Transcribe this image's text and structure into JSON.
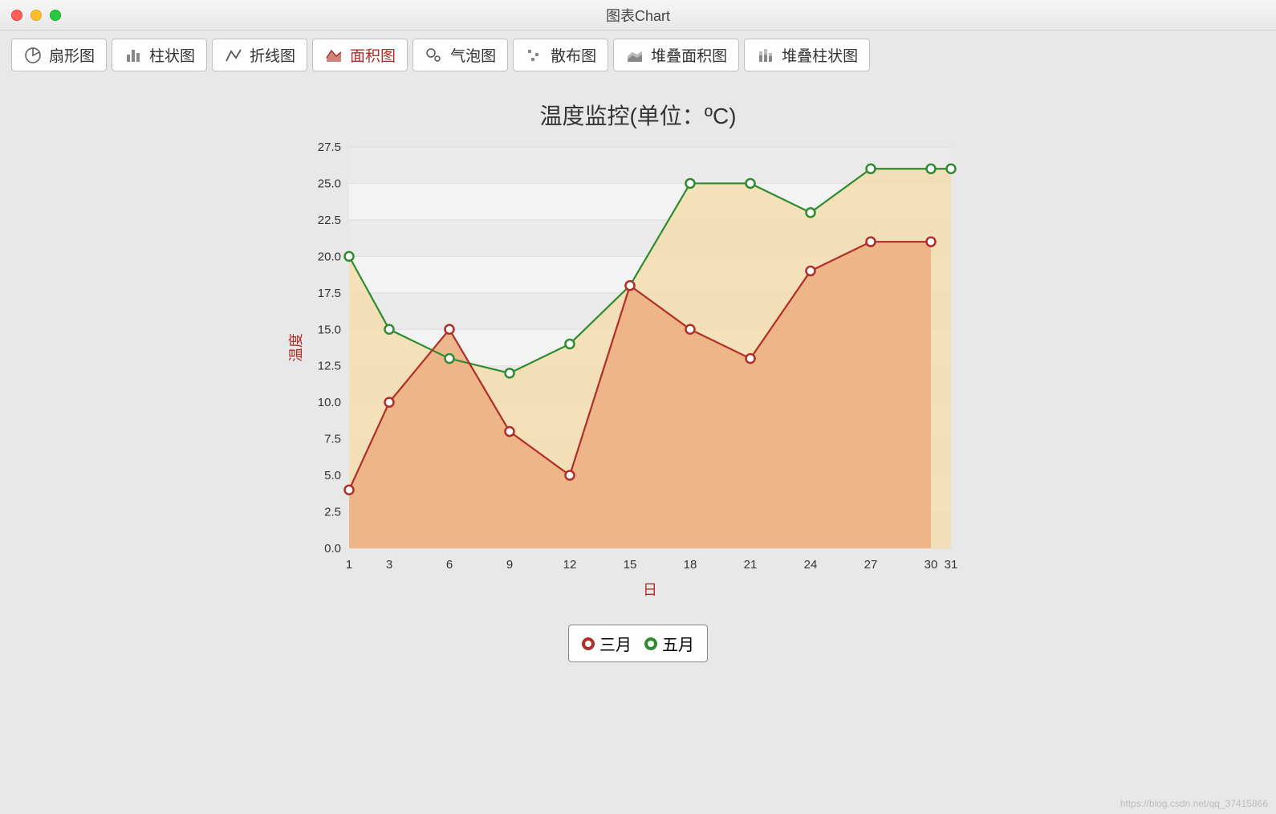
{
  "window": {
    "title": "图表Chart"
  },
  "tabs": [
    {
      "id": "pie",
      "label": "扇形图"
    },
    {
      "id": "bar",
      "label": "柱状图"
    },
    {
      "id": "line",
      "label": "折线图"
    },
    {
      "id": "area",
      "label": "面积图",
      "selected": true
    },
    {
      "id": "bubble",
      "label": "气泡图"
    },
    {
      "id": "scatter",
      "label": "散布图"
    },
    {
      "id": "stackedarea",
      "label": "堆叠面积图"
    },
    {
      "id": "stackedbar",
      "label": "堆叠柱状图"
    }
  ],
  "legend": {
    "series1": "三月",
    "series2": "五月"
  },
  "watermark": "https://blog.csdn.net/qq_37415866",
  "chart_data": {
    "type": "area",
    "title": "温度监控(单位：ºC)",
    "xlabel": "日",
    "ylabel": "温度",
    "x": [
      1,
      3,
      6,
      9,
      12,
      15,
      18,
      21,
      24,
      27,
      30,
      31
    ],
    "x_ticks": [
      "1",
      "3",
      "6",
      "9",
      "12",
      "15",
      "18",
      "21",
      "24",
      "27",
      "30",
      "31"
    ],
    "y_ticks": [
      "0.0",
      "2.5",
      "5.0",
      "7.5",
      "10.0",
      "12.5",
      "15.0",
      "17.5",
      "20.0",
      "22.5",
      "25.0",
      "27.5"
    ],
    "ylim": [
      0,
      27.5
    ],
    "series": [
      {
        "name": "三月",
        "color": "#b02e26",
        "fill": "#ecb083",
        "values": [
          4,
          10,
          15,
          8,
          5,
          18,
          15,
          13,
          19,
          21,
          21
        ]
      },
      {
        "name": "五月",
        "color": "#2e8b2e",
        "fill": "#f3dcae",
        "values": [
          20,
          15,
          13,
          12,
          14,
          18,
          25,
          25,
          23,
          26,
          26,
          26
        ]
      }
    ],
    "colors": {
      "series1": "#b02e26",
      "series2": "#2e8b2e"
    }
  }
}
